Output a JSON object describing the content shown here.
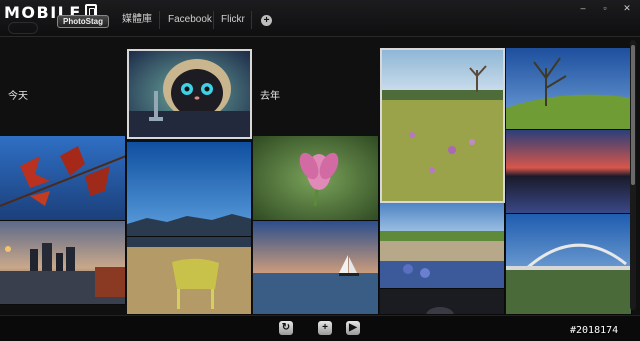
{
  "app": {
    "logo_text": "MOBILE",
    "badge": "PhotoStag"
  },
  "nav": {
    "items": [
      {
        "label": "媒體庫"
      },
      {
        "label": "Facebook"
      },
      {
        "label": "Flickr"
      }
    ],
    "add_label": "+"
  },
  "window_controls": {
    "minimize": "–",
    "maximize": "▫",
    "close": "✕"
  },
  "timeline": {
    "groups": [
      {
        "label": "今天"
      },
      {
        "label": "去年"
      }
    ]
  },
  "photos": [
    {
      "name": "cartoon-cat-photo",
      "subject": "cartoon cat"
    },
    {
      "name": "red-leaves-photo",
      "subject": "red leaves"
    },
    {
      "name": "city-skyline-photo",
      "subject": "city skyline"
    },
    {
      "name": "sky-field-chair-photo",
      "subject": "chair in field"
    },
    {
      "name": "pink-flower-photo",
      "subject": "pink flower"
    },
    {
      "name": "sailboat-sunset-photo",
      "subject": "sailboat"
    },
    {
      "name": "wildflower-field-photo",
      "subject": "wildflower field"
    },
    {
      "name": "stone-wall-flowers-photo",
      "subject": "stone wall"
    },
    {
      "name": "park-tree-photo",
      "subject": "park tree"
    },
    {
      "name": "lake-sunset-photo",
      "subject": "lake sunset"
    },
    {
      "name": "arch-bridge-photo",
      "subject": "arch bridge"
    }
  ],
  "toolbar": {
    "refresh_icon": "refresh-icon",
    "add_icon": "plus-icon",
    "play_icon": "play-icon",
    "refresh_glyph": "↻",
    "add_glyph": "+",
    "play_glyph": "▶"
  },
  "watermark": "#2018174"
}
